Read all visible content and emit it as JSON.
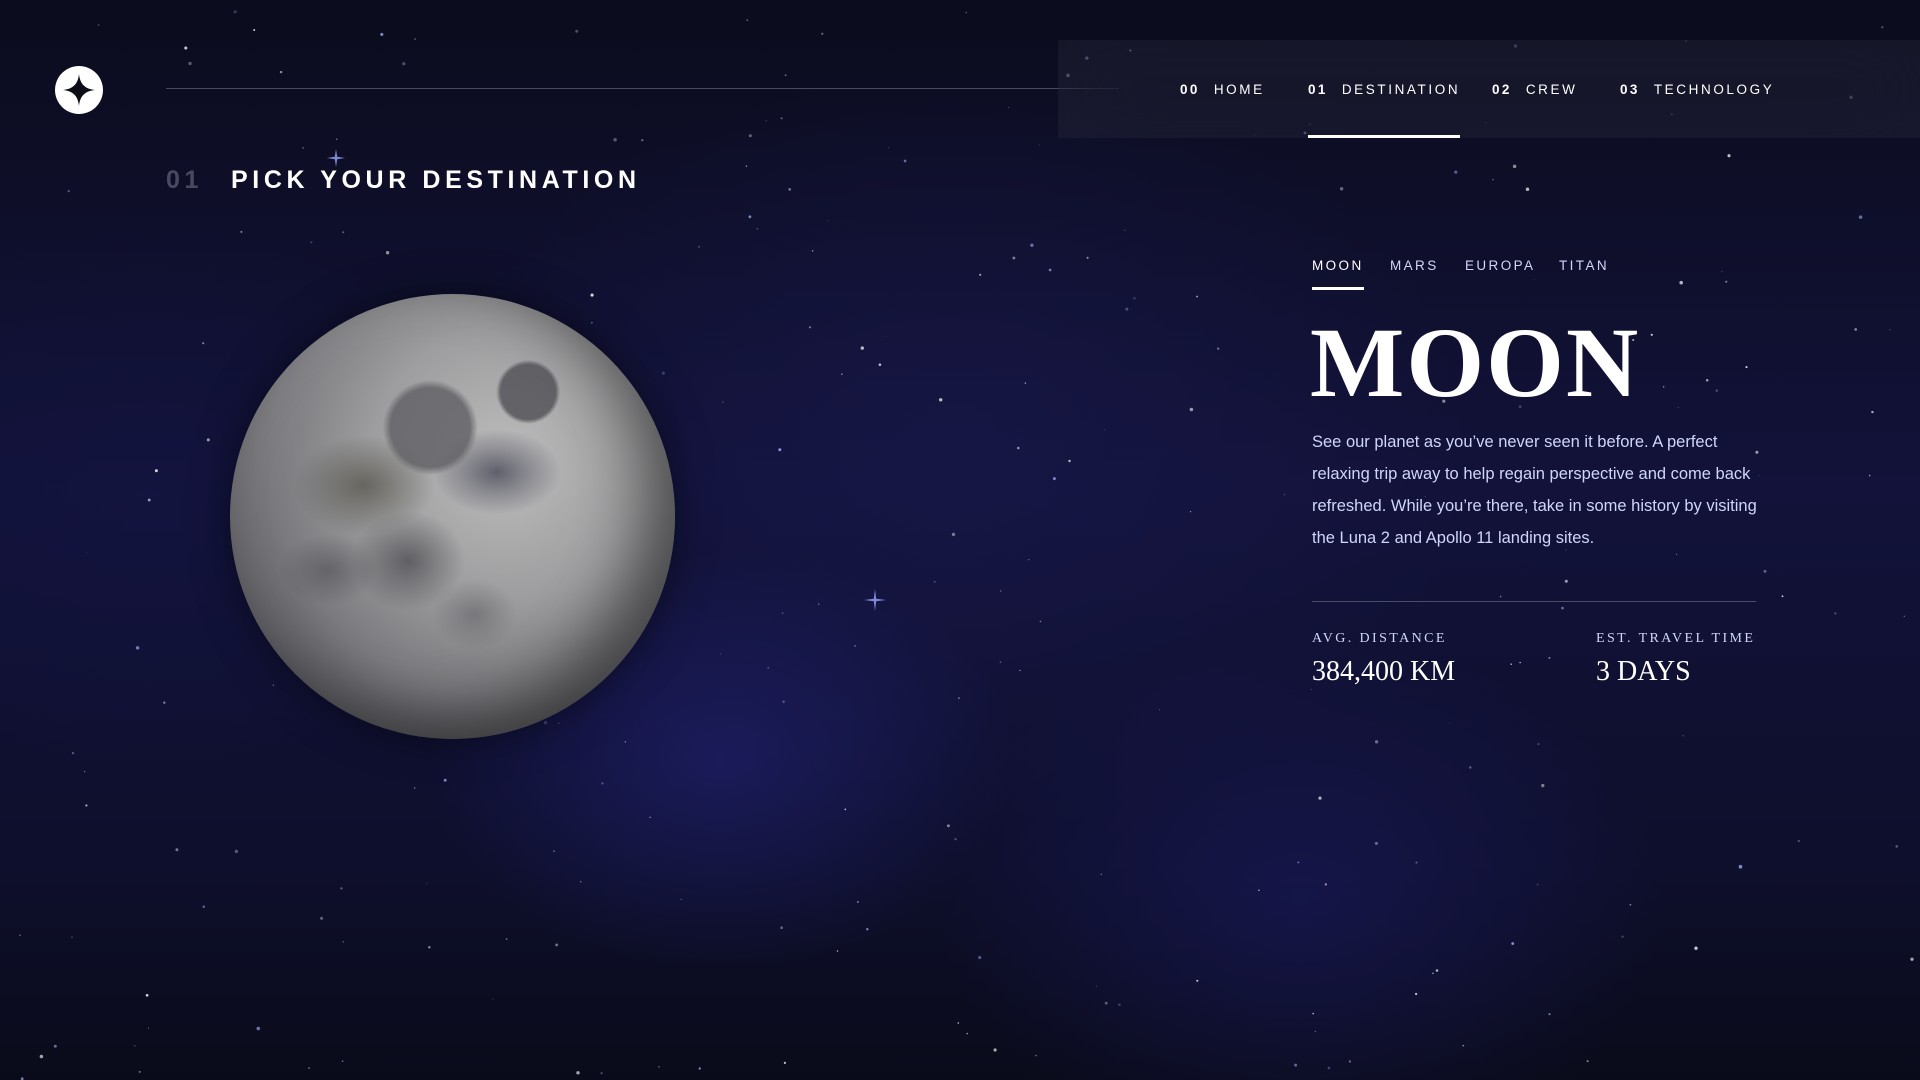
{
  "colors": {
    "background": "#0b0d17",
    "text": "#ffffff",
    "muted": "#d0d6f9"
  },
  "logo": {
    "icon": "four-point-star-icon"
  },
  "nav": {
    "items": [
      {
        "num": "00",
        "label": "HOME",
        "active": false
      },
      {
        "num": "01",
        "label": "DESTINATION",
        "active": true
      },
      {
        "num": "02",
        "label": "CREW",
        "active": false
      },
      {
        "num": "03",
        "label": "TECHNOLOGY",
        "active": false
      }
    ]
  },
  "heading": {
    "num": "01",
    "title": "PICK YOUR DESTINATION"
  },
  "destination": {
    "tabs": [
      {
        "label": "MOON",
        "active": true
      },
      {
        "label": "MARS",
        "active": false
      },
      {
        "label": "EUROPA",
        "active": false
      },
      {
        "label": "TITAN",
        "active": false
      }
    ],
    "name": "MOON",
    "description": "See our planet as you’ve never seen it before. A perfect relaxing trip away to help regain perspective and come back refreshed. While you’re there, take in some history by visiting the Luna 2 and Apollo 11 landing sites.",
    "stats": {
      "distance_label": "AVG. DISTANCE",
      "distance_value": "384,400 KM",
      "travel_label": "EST. TRAVEL TIME",
      "travel_value": "3 DAYS"
    }
  }
}
